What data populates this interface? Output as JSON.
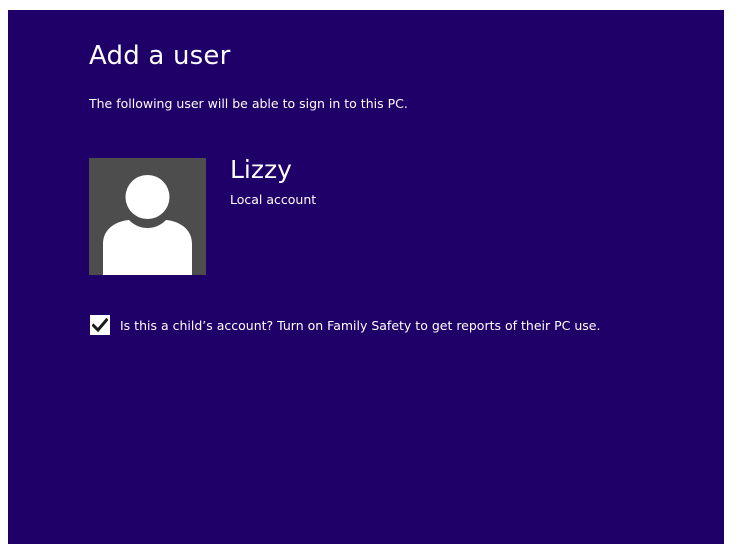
{
  "page": {
    "title": "Add a user",
    "subtitle": "The following user will be able to sign in to this PC."
  },
  "user": {
    "name": "Lizzy",
    "account_type": "Local account",
    "avatar_icon": "user-silhouette-icon"
  },
  "child_account": {
    "checked": true,
    "label": "Is this a child’s account? Turn on Family Safety to get reports of their PC use."
  },
  "colors": {
    "background": "#1f0068",
    "avatar_background": "#4d4d4d",
    "text": "#ffffff"
  }
}
